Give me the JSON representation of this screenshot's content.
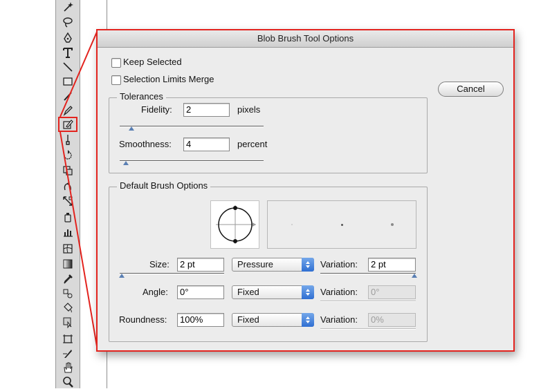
{
  "dialog": {
    "title": "Blob Brush Tool Options",
    "keep_selected": {
      "label": "Keep Selected",
      "checked": false
    },
    "selection_limits_merge": {
      "label": "Selection Limits Merge",
      "checked": false
    },
    "cancel_label": "Cancel",
    "tolerances": {
      "title": "Tolerances",
      "fidelity": {
        "label": "Fidelity:",
        "value": "2",
        "unit": "pixels",
        "slider_level": 0.08
      },
      "smoothness": {
        "label": "Smoothness:",
        "value": "4",
        "unit": "percent",
        "slider_level": 0.04
      }
    },
    "brush": {
      "title": "Default Brush Options",
      "size": {
        "label": "Size:",
        "value": "2 pt",
        "mode": "Pressure",
        "variation_label": "Variation:",
        "variation_value": "2 pt",
        "variation_enabled": true
      },
      "angle": {
        "label": "Angle:",
        "value": "0°",
        "mode": "Fixed",
        "variation_label": "Variation:",
        "variation_value": "0°",
        "variation_enabled": false
      },
      "roundness": {
        "label": "Roundness:",
        "value": "100%",
        "mode": "Fixed",
        "variation_label": "Variation:",
        "variation_value": "0%",
        "variation_enabled": false
      }
    }
  },
  "toolbox": {
    "tools": [
      "magic-wand-icon",
      "lasso-icon",
      "pen-icon",
      "type-icon",
      "line-segment-icon",
      "rectangle-icon",
      "paintbrush-icon",
      "pencil-icon",
      "blob-brush-icon",
      "eraser-icon",
      "rotate-icon",
      "scale-icon",
      "warp-icon",
      "free-transform-icon",
      "symbol-sprayer-icon",
      "column-graph-icon",
      "mesh-icon",
      "gradient-icon",
      "eyedropper-icon",
      "blend-icon",
      "live-paint-bucket-icon",
      "live-paint-selection-icon",
      "artboard-icon",
      "slice-icon",
      "hand-icon",
      "zoom-icon"
    ],
    "selected": "blob-brush-icon"
  },
  "colors": {
    "highlight": "#e3231e",
    "slider_thumb": "#5a7fb3",
    "select_arrow": "#2f6fd2"
  }
}
